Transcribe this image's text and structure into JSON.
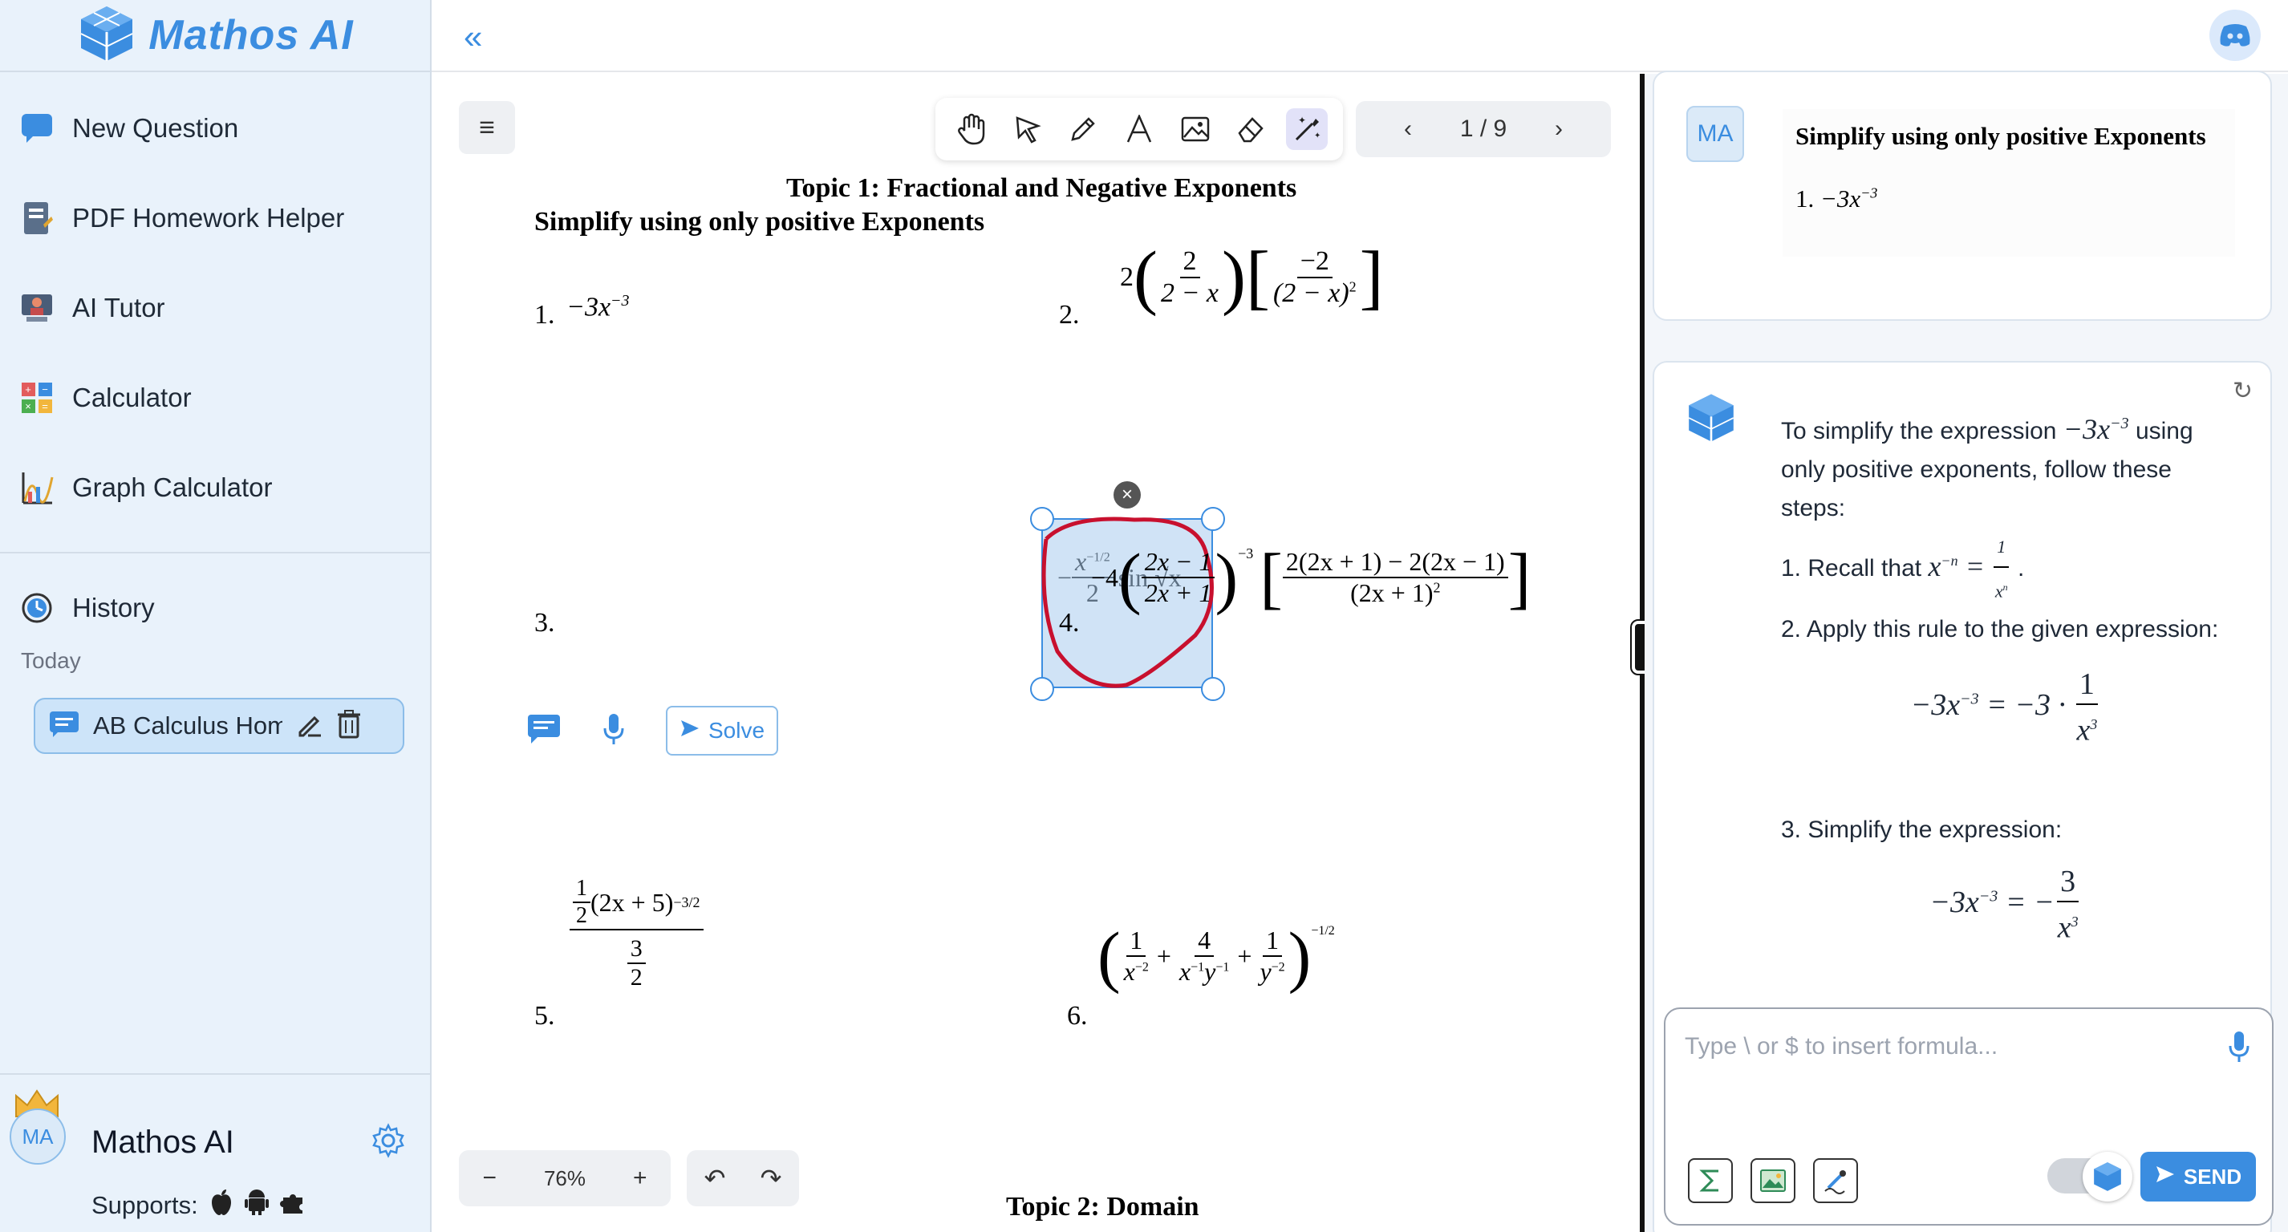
{
  "brand": {
    "name": "Mathos AI"
  },
  "sidebar": {
    "items": [
      {
        "label": "New Question",
        "icon": "chat-bubble-icon"
      },
      {
        "label": "PDF Homework Helper",
        "icon": "pdf-icon"
      },
      {
        "label": "AI Tutor",
        "icon": "tutor-icon"
      },
      {
        "label": "Calculator",
        "icon": "calculator-icon"
      },
      {
        "label": "Graph Calculator",
        "icon": "graph-icon"
      }
    ],
    "history_label": "History",
    "today_label": "Today",
    "history_items": [
      {
        "label": "AB Calculus Homework"
      }
    ]
  },
  "footer": {
    "avatar_initials": "MA",
    "user_name": "Mathos AI",
    "supports_label": "Supports:"
  },
  "viewer": {
    "page_indicator": "1 / 9",
    "zoom": "76%",
    "solve_label": "Solve",
    "doc": {
      "title": "Topic 1: Fractional and Negative Exponents",
      "subtitle": "Simplify using only positive Exponents",
      "footer_title": "Topic 2: Domain",
      "problem_numbers": [
        "1.",
        "2.",
        "3.",
        "4.",
        "5.",
        "6."
      ]
    }
  },
  "chat": {
    "user_avatar": "MA",
    "user_image": {
      "heading": "Simplify using only positive Exponents",
      "problem": "1."
    },
    "answer": {
      "intro_a": "To simplify the expression",
      "intro_b": "using only positive exponents, follow these steps:",
      "step1": "1. Recall that",
      "step2": "2. Apply this rule to the given expression:",
      "step3": "3. Simplify the expression:"
    },
    "input_placeholder": "Type \\ or $ to insert formula...",
    "send_label": "SEND"
  },
  "colors": {
    "accent": "#3b8de0",
    "sidebar_bg": "#e9f2fb",
    "selection_red": "#c8102e"
  }
}
